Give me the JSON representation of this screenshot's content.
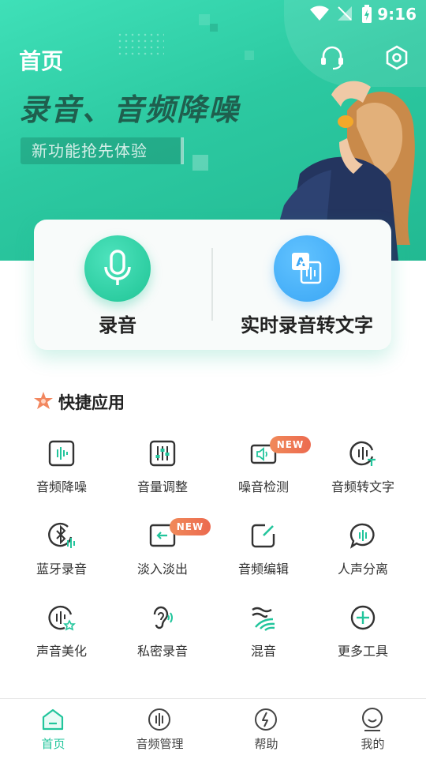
{
  "colors": {
    "accent": "#22c59c",
    "badge": "#ec6a4f",
    "blue": "#3aa6f5"
  },
  "status_bar": {
    "time": "9:16"
  },
  "header": {
    "title": "首页",
    "icons": [
      "headset-icon",
      "settings-icon"
    ]
  },
  "banner": {
    "title": "录音、音频降噪",
    "subtitle": "新功能抢先体验"
  },
  "card": {
    "record_label": "录音",
    "transcribe_label": "实时录音转文字"
  },
  "section": {
    "title": "快捷应用"
  },
  "tools": [
    {
      "label": "音频降噪",
      "icon": "waveform-box-icon"
    },
    {
      "label": "音量调整",
      "icon": "sliders-icon"
    },
    {
      "label": "噪音检测",
      "icon": "speaker-icon",
      "badge": "NEW"
    },
    {
      "label": "音频转文字",
      "icon": "audio-to-text-icon"
    },
    {
      "label": "蓝牙录音",
      "icon": "bluetooth-icon"
    },
    {
      "label": "淡入淡出",
      "icon": "fade-icon",
      "badge": "NEW"
    },
    {
      "label": "音频编辑",
      "icon": "edit-icon"
    },
    {
      "label": "人声分离",
      "icon": "chat-bubble-icon"
    },
    {
      "label": "声音美化",
      "icon": "beautify-icon"
    },
    {
      "label": "私密录音",
      "icon": "ear-icon"
    },
    {
      "label": "混音",
      "icon": "mix-icon"
    },
    {
      "label": "更多工具",
      "icon": "plus-circle-icon"
    }
  ],
  "nav": [
    {
      "label": "首页",
      "icon": "home-icon",
      "active": true
    },
    {
      "label": "音频管理",
      "icon": "audio-manage-icon"
    },
    {
      "label": "帮助",
      "icon": "help-icon"
    },
    {
      "label": "我的",
      "icon": "profile-icon"
    }
  ]
}
